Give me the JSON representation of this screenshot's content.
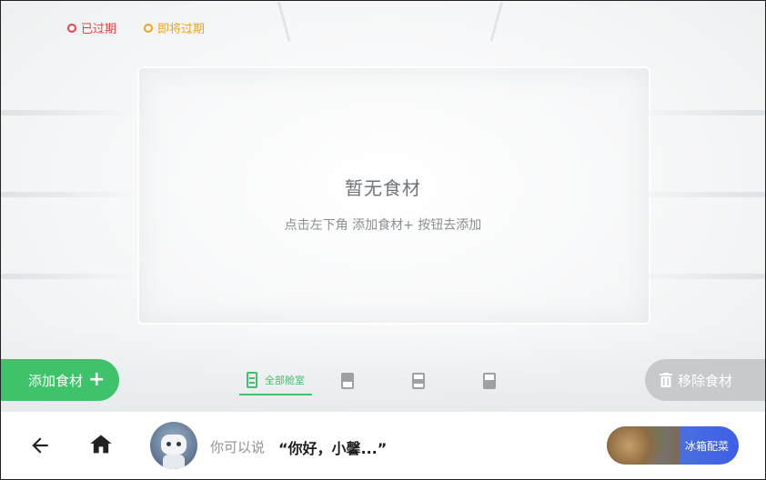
{
  "legend": {
    "expired": {
      "label": "已过期",
      "color": "#e8413f"
    },
    "expiring": {
      "label": "即将过期",
      "color": "#f2a21b"
    }
  },
  "empty_state": {
    "title": "暂无食材",
    "subtitle": "点击左下角 添加食材+ 按钮去添加"
  },
  "actions": {
    "add_label": "添加食材",
    "remove_label": "移除食材"
  },
  "tabs": [
    {
      "label": "全部舱室",
      "icon": "cabinet-all-icon",
      "active": true
    },
    {
      "label": "",
      "icon": "compartment-top-icon",
      "active": false
    },
    {
      "label": "",
      "icon": "compartment-middle-icon",
      "active": false
    },
    {
      "label": "",
      "icon": "compartment-bottom-icon",
      "active": false
    }
  ],
  "bottom_bar": {
    "hint": "你可以说",
    "quote": "“你好，小馨...”",
    "recipe_label": "冰箱配菜"
  },
  "colors": {
    "accent": "#3ec26a",
    "disabled": "#c7c9cb"
  }
}
